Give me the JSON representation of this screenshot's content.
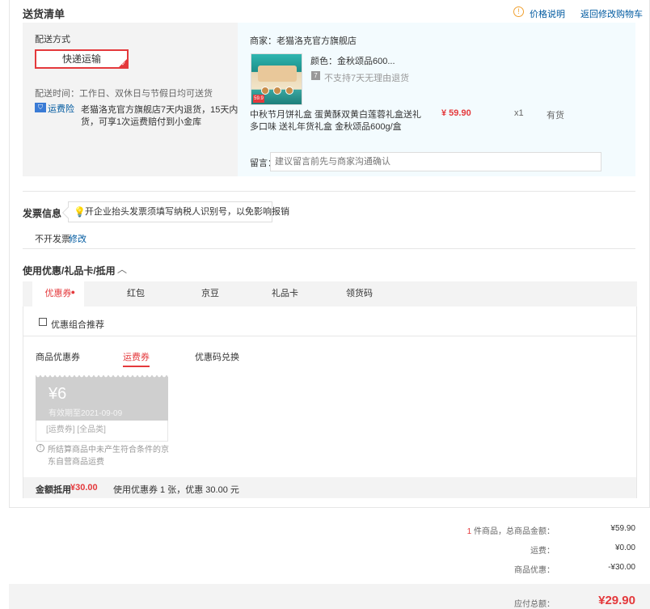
{
  "shipping": {
    "title": "送货清单",
    "price_info_label": "价格说明",
    "back_to_cart": "返回修改购物车",
    "method_label": "配送方式",
    "method_value": "快递运输",
    "delivery_time": "配送时间：工作日、双休日与节假日均可送货",
    "insurance_name": "运费险",
    "insurance_desc_1": "老猫洛克官方旗舰店7天内退货，15天内换",
    "insurance_desc_2": "货，可享1次运费赔付到小金库",
    "merchant": "商家：老猫洛克官方旗舰店",
    "product": {
      "color": "颜色：金秋颂品600...",
      "no_return": "不支持7天无理由退货",
      "no_return_badge": "7",
      "name_1": "中秋节月饼礼盒 蛋黄酥双黄白莲蓉礼盒送礼",
      "name_2": "多口味 送礼年货礼盒 金秋颂品600g/盒",
      "price": "¥ 59.90",
      "qty": "x1",
      "stock": "有货",
      "thumb_badge": "59.9"
    },
    "message_label": "留言：",
    "message_placeholder": "建议留言前先与商家沟通确认"
  },
  "invoice": {
    "title": "发票信息",
    "tip": "开企业抬头发票须填写纳税人识别号，以免影响报销",
    "value": "不开发票",
    "edit": "修改"
  },
  "coupons": {
    "title": "使用优惠/礼品卡/抵用",
    "tabs": [
      "优惠券",
      "红包",
      "京豆",
      "礼品卡",
      "领货码"
    ],
    "combo_label": "优惠组合推荐",
    "subtabs": [
      "商品优惠券",
      "运费券",
      "优惠码兑换"
    ],
    "card": {
      "amount": "¥6",
      "expiry": "有效期至2021-09-09",
      "tags": "[运费券] [全品类]"
    },
    "note_1": "所结算商品中未产生符合条件的京",
    "note_2": "东自营商品运费",
    "footer_label": "金额抵用",
    "footer_amount": "¥30.00",
    "footer_desc": "使用优惠券 1 张，优惠 30.00 元"
  },
  "summary": {
    "count": "1",
    "count_suffix": " 件商品，总商品金额：",
    "goods_total": "¥59.90",
    "freight_label": "运费：",
    "freight": "¥0.00",
    "discount_label": "商品优惠：",
    "discount": "-¥30.00",
    "payable_label": "应付总额：",
    "payable": "¥29.90"
  },
  "colors": {
    "accent": "#e4393c",
    "link": "#005aa0",
    "panel_blue": "#f3fbfe",
    "panel_gray": "#f3f3f3"
  }
}
